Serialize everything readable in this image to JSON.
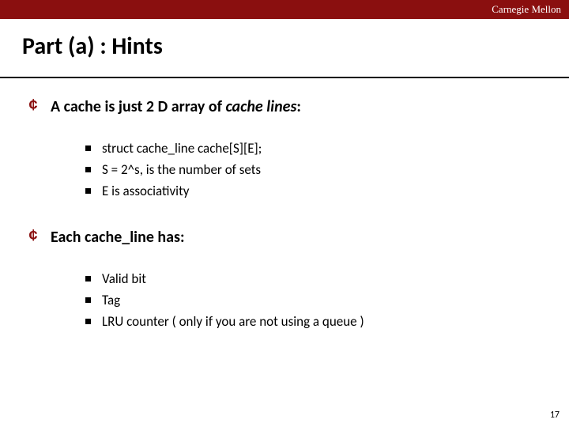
{
  "header": {
    "org": "Carnegie Mellon"
  },
  "title": "Part (a) : Hints",
  "sections": [
    {
      "heading": "A cache is just 2 D array of cache lines:",
      "items": [
        "struct cache_line cache[S][E];",
        "S = 2^s,  is the number of sets",
        "E is associativity"
      ]
    },
    {
      "heading": "Each cache_line has:",
      "items": [
        "Valid bit",
        "Tag",
        "LRU counter ( only if you are not using a queue )"
      ]
    }
  ],
  "page_number": "17",
  "colors": {
    "brand": "#8a0f0f"
  }
}
